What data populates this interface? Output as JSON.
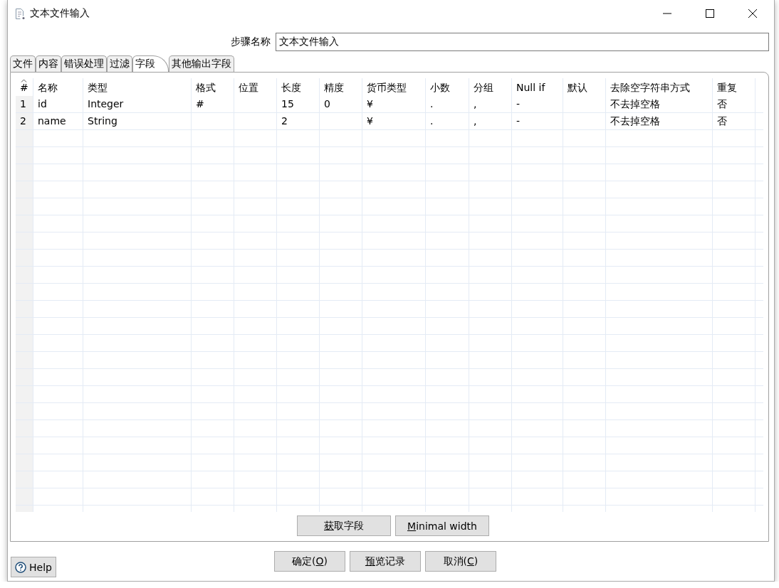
{
  "window": {
    "title": "文本文件输入"
  },
  "step_name": {
    "label": "步骤名称",
    "value": "文本文件输入"
  },
  "tabs": [
    {
      "label": "文件",
      "selected": false
    },
    {
      "label": "内容",
      "selected": false
    },
    {
      "label": "错误处理",
      "selected": false
    },
    {
      "label": "过滤",
      "selected": false
    },
    {
      "label": "字段",
      "selected": true
    },
    {
      "label": "其他输出字段",
      "selected": false
    }
  ],
  "table": {
    "columns": [
      "#",
      "名称",
      "类型",
      "格式",
      "位置",
      "长度",
      "精度",
      "货币类型",
      "小数",
      "分组",
      "Null if",
      "默认",
      "去除空字符串方式",
      "重复"
    ],
    "rows": [
      [
        "1",
        "id",
        "Integer",
        "#",
        null,
        "15",
        "0",
        "¥",
        ".",
        ",",
        "-",
        null,
        "不去掉空格",
        "否"
      ],
      [
        "2",
        "name",
        "String",
        null,
        null,
        "2",
        null,
        "¥",
        ".",
        ",",
        "-",
        null,
        "不去掉空格",
        "否"
      ]
    ]
  },
  "table_buttons": [
    {
      "key": "获",
      "post": "取字段"
    },
    {
      "key": "M",
      "post": "inimal width"
    }
  ],
  "help_button": {
    "label": "Help"
  },
  "dialog_buttons": [
    {
      "pre": "确定(",
      "key": "O",
      "post": ")"
    },
    {
      "key": "预",
      "post": "览记录"
    },
    {
      "pre": "取消(",
      "key": "C",
      "post": ")"
    }
  ]
}
